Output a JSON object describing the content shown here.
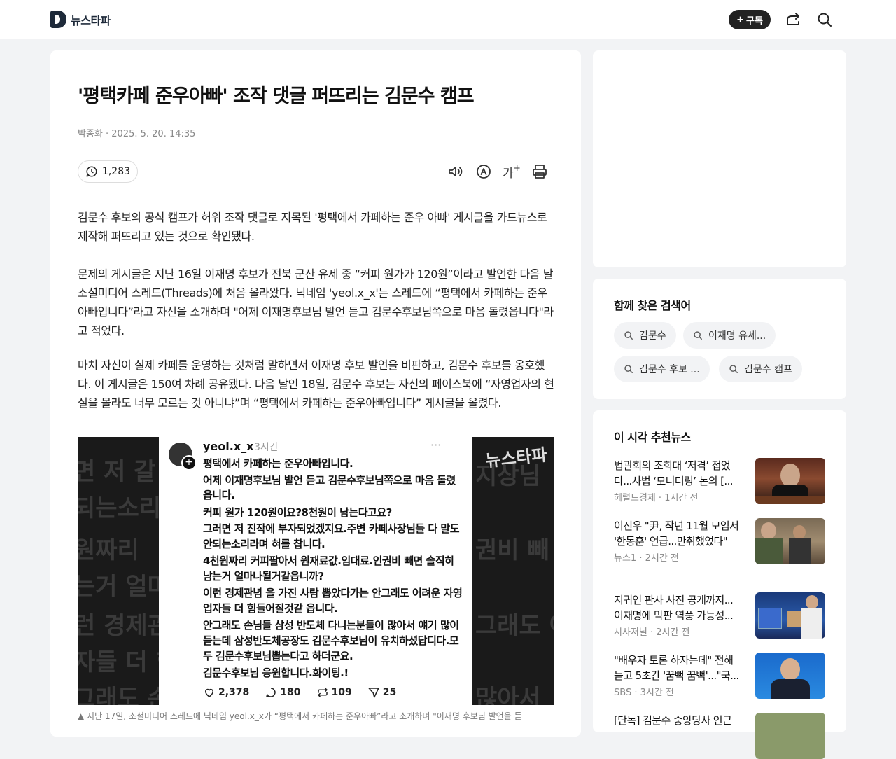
{
  "header": {
    "logo_text": "뉴스타파",
    "subscribe_label": "구독",
    "subscribe_plus": "+"
  },
  "article": {
    "title": "'평택카페 준우아빠' 조작 댓글 퍼뜨리는 김문수 캠프",
    "meta": "박종화 · 2025. 5. 20. 14:35",
    "comment_count": "1,283",
    "font_size_label": "가",
    "paragraphs": [
      "김문수 후보의 공식 캠프가 허위 조작 댓글로 지목된 '평택에서 카페하는 준우 아빠' 게시글을 카드뉴스로 제작해 퍼뜨리고 있는 것으로 확인됐다.",
      "문제의 게시글은 지난 16일 이재명 후보가 전북 군산 유세 중 “커피 원가가 120원”이라고 발언한 다음 날 소셜미디어 스레드(Threads)에 처음 올라왔다. 닉네임 'yeol.x_x'는 스레드에 “평택에서 카페하는 준우아빠입니다”라고 자신을 소개하며 \"어제 이재명후보님 발언 듣고 김문수후보님쪽으로 마음 돌렸읍니다\"라고 적었다.",
      "마치 자신이 실제 카페를 운영하는 것처럼 말하면서 이재명 후보 발언을 비판하고, 김문수 후보를 옹호했다. 이 게시글은 150여 차례 공유됐다. 다음 날인 18일, 김문수 후보는 자신의 페이스북에 “자영업자의 현실을 몰라도 너무 모르는 것 아니냐”며 “평택에서 카페하는 준우아빠입니다” 게시글을 올렸다."
    ],
    "image": {
      "post_user": "yeol.x_x",
      "post_time": "3시간",
      "post_more": "···",
      "watermark": "뉴스타파",
      "post_lines": [
        "평택에서 카페하는 준우아빠입니다.",
        "어제 이재명후보님 발언 듣고 김문수후보님쪽으로 마음 돌렸",
        "읍니다.",
        "커피 원가 120원이요?8천원이 남는다고요?",
        "그러면 저 진작에 부자되었겠지요.주변 카페사장님들 다 말도",
        "안되는소리라며 혀를 찹니다.",
        "4천원짜리 커피팔아서 원재료값.임대료.인권비 빼면 솔직히",
        "남는거 얼마나될거같읍니까?",
        "이런 경제관념 을 가진 사람 뽑았다가는 안그래도 어려운 자영",
        "업자들 더 힘들어질것같 읍니다.",
        "안그래도 손님들 삼성 반도체 다니는분들이 많아서 얘기 많이",
        "듣는데 삼성반도체공장도 김문수후보님이 유치하셨답디다.모",
        "두 김문수후보님뽑는다고 하더군요.",
        "김문수후보님 응원합니다.화이팅.!"
      ],
      "stats": {
        "likes": "2,378",
        "comments": "180",
        "reposts": "109",
        "shares": "25"
      },
      "bg_left": [
        "면 저 갈",
        "되는소리",
        "원짜리",
        "는거 얼마",
        "런 경제관",
        "자들 더 힘",
        "그래도 손"
      ],
      "bg_right": [
        "지상님",
        "",
        "권비 빼",
        "",
        "그래도 어",
        "",
        "많아서"
      ]
    },
    "caption": "▲ 지난 17일, 소셜미디어 스레드에 닉네임 yeol.x_x가 “평택에서 카페하는 준우아빠”라고 소개하며 \"이재명 후보님 발언을 듣"
  },
  "sidebar": {
    "related_title": "함께 찾은 검색어",
    "chips": [
      "김문수",
      "이재명 유세...",
      "김문수 후보 ...",
      "김문수 캠프"
    ],
    "rec_title": "이 시각 추천뉴스",
    "news": [
      {
        "title": "법관회의 조희대 ‘저격’ 접었다...사법 ‘모니터링’ 논의 [...",
        "source": "헤럴드경제 · 1시간 전"
      },
      {
        "title": "이진우 \"尹, 작년 11월 모임서 '한동훈' 언급...만취했었다\"",
        "source": "뉴스1 · 2시간 전"
      },
      {
        "title": "지귀연 판사 사진 공개까지... 이재명에 막판 역풍 가능성...",
        "source": "시사저널 · 2시간 전"
      },
      {
        "title": "\"배우자 토론 하자는데\" 전해 듣고 5초간 '꿈뻑 꿈뻑'...\"국...",
        "source": "SBS · 3시간 전"
      },
      {
        "title": "[단독] 김문수 중앙당사 인근",
        "source": ""
      }
    ]
  }
}
